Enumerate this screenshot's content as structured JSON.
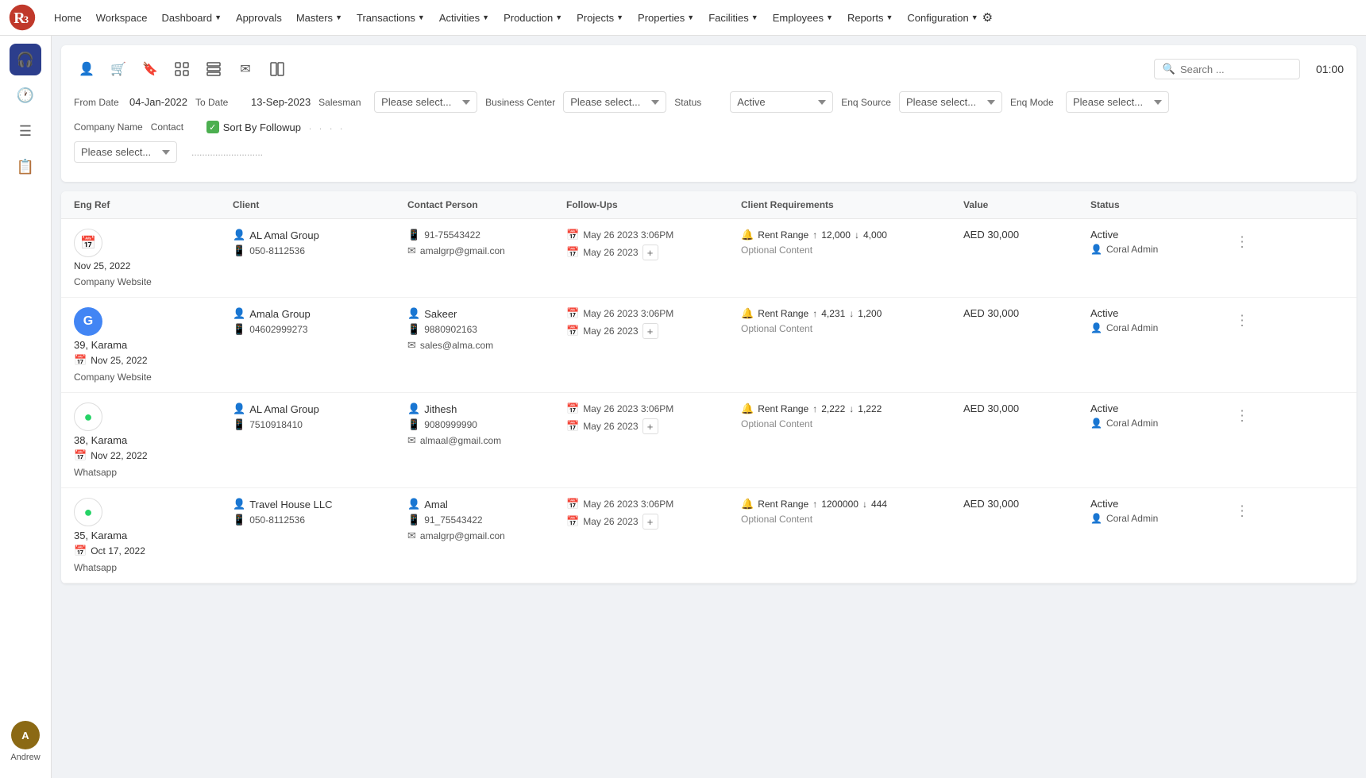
{
  "nav": {
    "brand": "R3",
    "items": [
      {
        "label": "Home",
        "hasDropdown": false
      },
      {
        "label": "Workspace",
        "hasDropdown": false
      },
      {
        "label": "Dashboard",
        "hasDropdown": true
      },
      {
        "label": "Approvals",
        "hasDropdown": false
      },
      {
        "label": "Masters",
        "hasDropdown": true
      },
      {
        "label": "Transactions",
        "hasDropdown": true
      },
      {
        "label": "Activities",
        "hasDropdown": true
      },
      {
        "label": "Production",
        "hasDropdown": true
      },
      {
        "label": "Projects",
        "hasDropdown": true
      },
      {
        "label": "Properties",
        "hasDropdown": true
      },
      {
        "label": "Facilities",
        "hasDropdown": true
      },
      {
        "label": "Employees",
        "hasDropdown": true
      },
      {
        "label": "Reports",
        "hasDropdown": true
      },
      {
        "label": "Configuration",
        "hasDropdown": true
      }
    ]
  },
  "sidebar": {
    "icons": [
      {
        "name": "headset-icon",
        "symbol": "🎧",
        "active": true
      },
      {
        "name": "clock-icon",
        "symbol": "🕐",
        "active": false
      },
      {
        "name": "list-icon",
        "symbol": "☰",
        "active": false
      },
      {
        "name": "clipboard-icon",
        "symbol": "📋",
        "active": false
      }
    ],
    "user": {
      "name": "Andrew",
      "initials": "A"
    }
  },
  "toolbar": {
    "icons": [
      {
        "name": "person-icon",
        "symbol": "👤"
      },
      {
        "name": "cart-icon",
        "symbol": "🛒"
      },
      {
        "name": "bookmark-icon",
        "symbol": "🔖"
      },
      {
        "name": "grid-icon",
        "symbol": "⊞"
      },
      {
        "name": "table-icon",
        "symbol": "⊟"
      },
      {
        "name": "mail-icon",
        "symbol": "✉"
      },
      {
        "name": "panel-icon",
        "symbol": "⬜"
      }
    ],
    "search_placeholder": "Search ...",
    "time": "01:00"
  },
  "filters": {
    "from_date_label": "From Date",
    "from_date_value": "04-Jan-2022",
    "to_date_label": "To Date",
    "to_date_value": "13-Sep-2023",
    "salesman_label": "Salesman",
    "salesman_placeholder": "Please select...",
    "business_center_label": "Business Center",
    "business_center_placeholder": "Please select...",
    "status_label": "Status",
    "status_value": "Active",
    "enq_source_label": "Enq Source",
    "enq_source_placeholder": "Please select...",
    "enq_mode_label": "Enq Mode",
    "enq_mode_placeholder": "Please select...",
    "company_name_label": "Company Name",
    "contact_label": "Contact",
    "sort_by_followup": "Sort By Followup",
    "company_select_placeholder": "Please select...",
    "dotted_field": "..........................."
  },
  "table": {
    "headers": [
      "Eng Ref",
      "Client",
      "Contact Person",
      "Follow-Ups",
      "Client Requirements",
      "Value",
      "Status"
    ],
    "rows": [
      {
        "eng_ref_icon": "cal",
        "eng_ref_date": "Nov 25, 2022",
        "eng_ref_source": "Company Website",
        "client_name": "AL Amal Group",
        "client_phone1": "050-8112536",
        "contact_name": "",
        "contact_phone": "91-75543422",
        "contact_email": "amalgrp@gmail.con",
        "contact_phone_label": "91-75543422",
        "followup_date1": "May 26 2023 3:06PM",
        "followup_date2": "May 26 2023",
        "rent_range_label": "Rent Range",
        "rent_up": "12,000",
        "rent_down": "4,000",
        "optional_content": "Optional Content",
        "value": "AED 30,000",
        "status": "Active",
        "status_user": "Coral Admin"
      },
      {
        "eng_ref_icon": "g",
        "eng_ref_area": "39, Karama",
        "eng_ref_date": "Nov 25, 2022",
        "eng_ref_source": "Company Website",
        "client_name": "Amala Group",
        "client_phone1": "04602999273",
        "contact_name": "Sakeer",
        "contact_phone": "9880902163",
        "contact_email": "sales@alma.com",
        "followup_date1": "May 26 2023 3:06PM",
        "followup_date2": "May 26 2023",
        "rent_range_label": "Rent Range",
        "rent_up": "4,231",
        "rent_down": "1,200",
        "optional_content": "Optional Content",
        "value": "AED 30,000",
        "status": "Active",
        "status_user": "Coral Admin"
      },
      {
        "eng_ref_icon": "wa",
        "eng_ref_area": "38, Karama",
        "eng_ref_date": "Nov 22, 2022",
        "eng_ref_source": "Whatsapp",
        "client_name": "AL Amal Group",
        "client_phone1": "7510918410",
        "contact_name": "Jithesh",
        "contact_phone": "9080999990",
        "contact_email": "almaal@gmail.com",
        "followup_date1": "May 26 2023 3:06PM",
        "followup_date2": "May 26 2023",
        "rent_range_label": "Rent Range",
        "rent_up": "2,222",
        "rent_down": "1,222",
        "optional_content": "Optional Content",
        "value": "AED 30,000",
        "status": "Active",
        "status_user": "Coral Admin"
      },
      {
        "eng_ref_icon": "wa",
        "eng_ref_area": "35, Karama",
        "eng_ref_date": "Oct 17, 2022",
        "eng_ref_source": "Whatsapp",
        "client_name": "Travel House LLC",
        "client_phone1": "050-8112536",
        "contact_name": "Amal",
        "contact_phone": "91_75543422",
        "contact_email": "amalgrp@gmail.con",
        "followup_date1": "May 26 2023 3:06PM",
        "followup_date2": "May 26 2023",
        "rent_range_label": "Rent Range",
        "rent_up": "1200000",
        "rent_down": "444",
        "optional_content": "Optional Content",
        "value": "AED 30,000",
        "status": "Active",
        "status_user": "Coral Admin"
      }
    ]
  },
  "footer": {
    "status": "Active",
    "user": "Coral Admin"
  }
}
